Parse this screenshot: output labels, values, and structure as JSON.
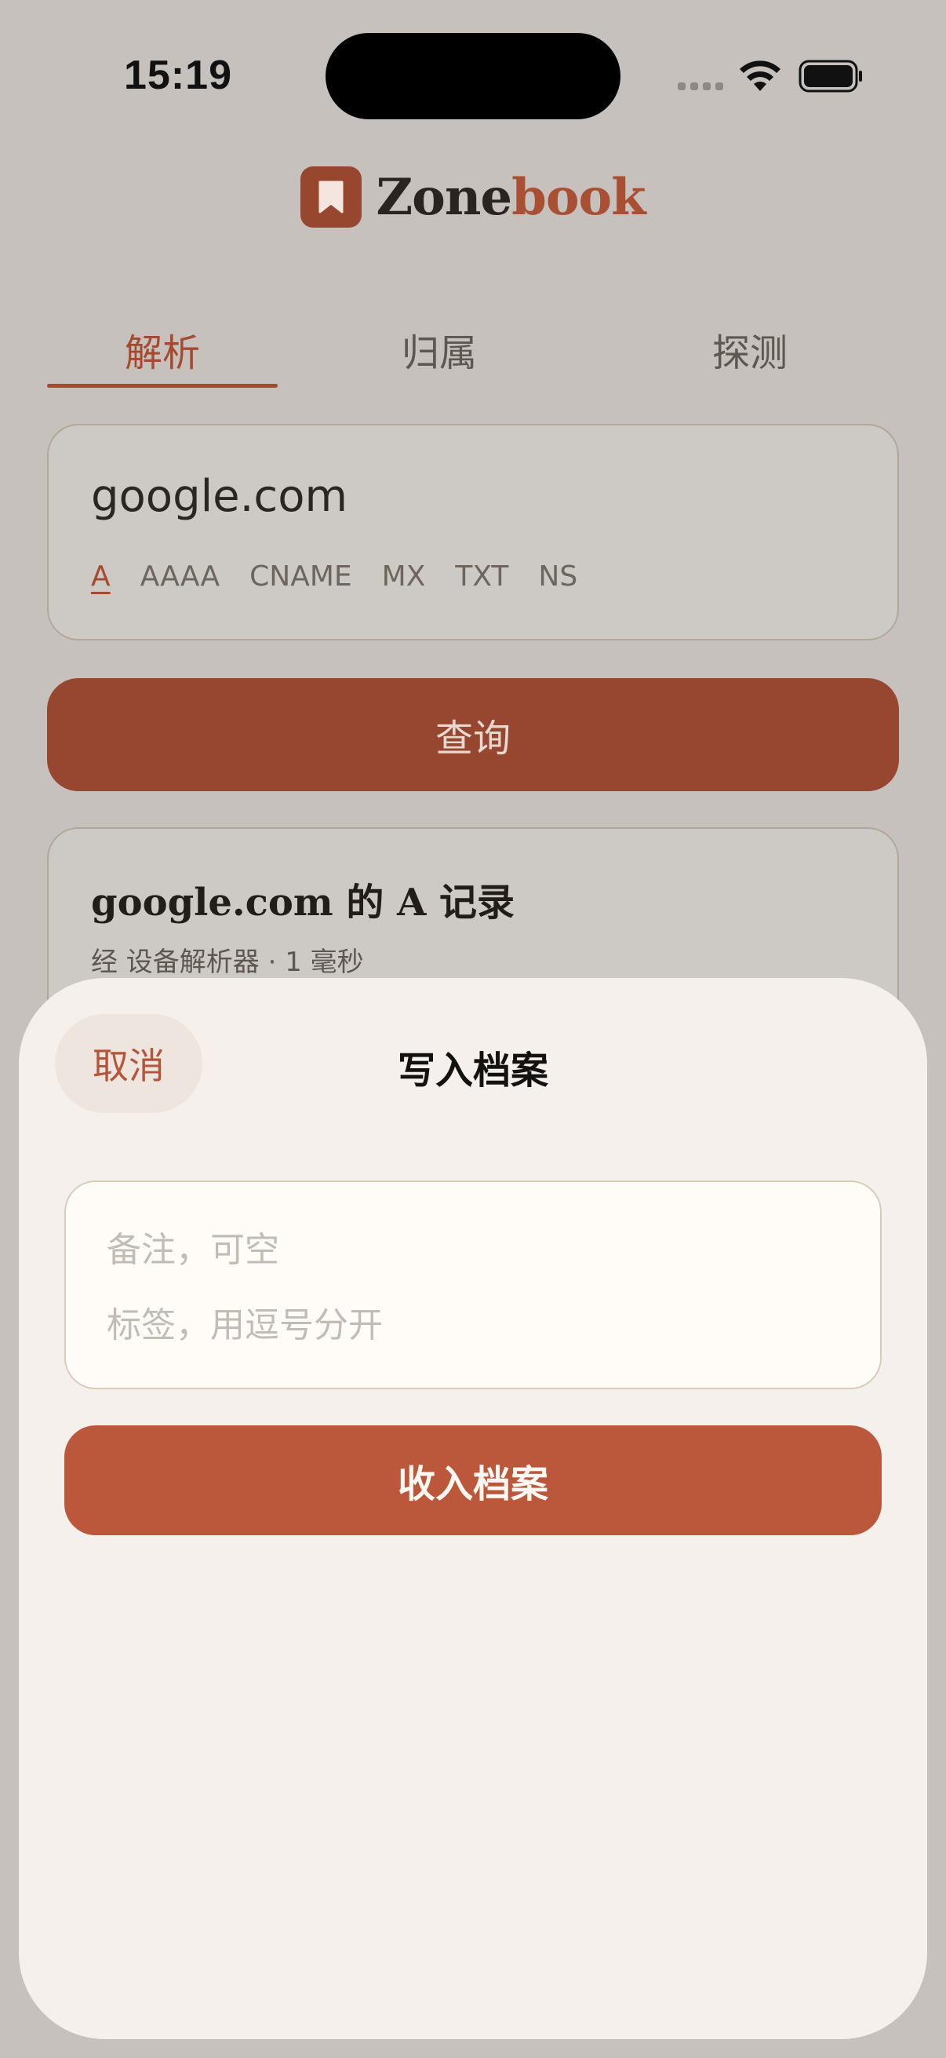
{
  "status_bar": {
    "time": "15:19"
  },
  "logo": {
    "part1": "Zone",
    "part2": "book"
  },
  "tabs": [
    {
      "label": "解析",
      "active": true
    },
    {
      "label": "归属",
      "active": false
    },
    {
      "label": "探测",
      "active": false
    }
  ],
  "query": {
    "domain": "google.com",
    "record_types": [
      "A",
      "AAAA",
      "CNAME",
      "MX",
      "TXT",
      "NS"
    ],
    "selected_type": "A",
    "button_label": "查询"
  },
  "result": {
    "title": "google.com 的 A 记录",
    "subtitle": "经 设备解析器 · 1 毫秒"
  },
  "sheet": {
    "cancel_label": "取消",
    "title": "写入档案",
    "note_placeholder": "备注，可空",
    "tags_placeholder": "标签，用逗号分开",
    "submit_label": "收入档案"
  },
  "colors": {
    "accent": "#a54a30",
    "button": "#974630",
    "sheet_button": "#bb583c",
    "background": "#c6c1bc",
    "sheet": "#f5f0eb"
  }
}
